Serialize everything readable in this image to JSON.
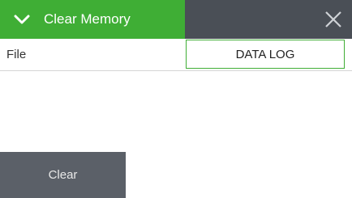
{
  "header": {
    "title": "Clear Memory",
    "collapse_icon": "chevron-down-icon",
    "close_icon": "close-icon",
    "accent_color": "#3fae35",
    "bar_color": "#4a4f56"
  },
  "file_row": {
    "label": "File",
    "value": "DATA LOG"
  },
  "actions": {
    "clear_label": "Clear",
    "clear_color": "#5b6068"
  }
}
